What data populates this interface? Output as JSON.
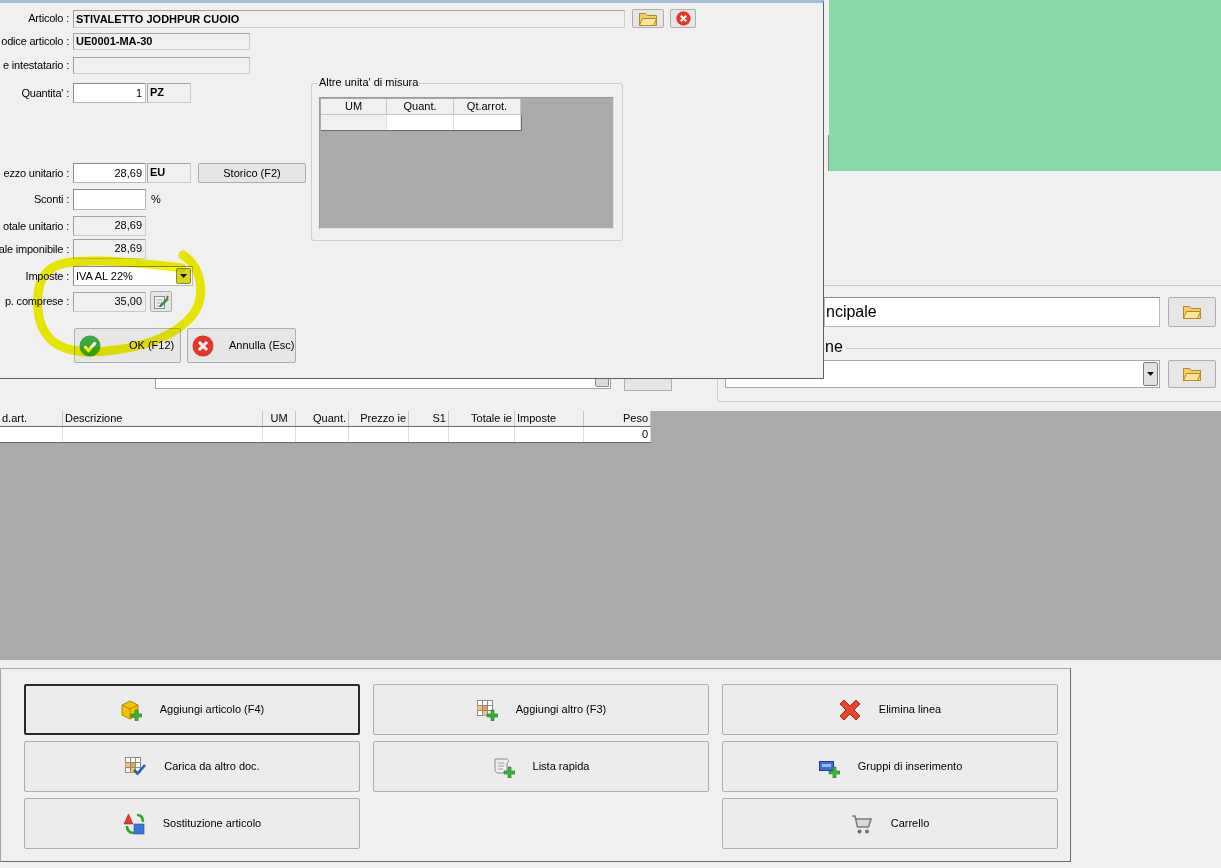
{
  "dialog": {
    "article": {
      "label": "Articolo :",
      "value": "STIVALETTO JODHPUR CUOIO"
    },
    "code": {
      "label": "odice articolo :",
      "value": "UE0001-MA-30"
    },
    "holder_code": {
      "label": "e intestatario :"
    },
    "quantity": {
      "label": "Quantita' :",
      "value": "1",
      "unit": "PZ"
    },
    "unit_price": {
      "label": "ezzo unitario :",
      "value": "28,69",
      "unit": "EU",
      "history_button": "Storico (F2)"
    },
    "discount": {
      "label": "Sconti :",
      "suffix": "%"
    },
    "unit_total": {
      "label": "otale unitario :",
      "value": "28,69"
    },
    "taxable_total": {
      "label": "ale imponibile :",
      "value": "28,69"
    },
    "tax": {
      "label": "Imposte :",
      "value": "IVA AL 22%"
    },
    "tax_included": {
      "label": "p. comprese :",
      "value": "35,00"
    },
    "buttons": [
      {
        "kind": "ok",
        "label": "OK (F12)"
      },
      {
        "kind": "cancel",
        "label": "Annulla (Esc)"
      }
    ],
    "units_group": {
      "title": "Altre unita' di misura",
      "columns": [
        "UM",
        "Quant.",
        "Qt.arrot."
      ]
    }
  },
  "main": {
    "address_field": {
      "value": "ncipale"
    },
    "payment_group": {
      "title": "ne"
    },
    "lines_table": {
      "columns": [
        "d.art.",
        "Descrizione",
        "UM",
        "Quant.",
        "Prezzo ie",
        "S1",
        "Totale ie",
        "Imposte",
        "Peso"
      ],
      "rows": [
        {
          "weight": "0"
        }
      ]
    },
    "action_columns": [
      [
        {
          "kind": "article",
          "label": "Aggiungi articolo (F4)",
          "focused": true
        },
        {
          "kind": "load",
          "label": "Carica da altro doc.",
          "focused": false
        },
        {
          "kind": "replace",
          "label": "Sostituzione articolo",
          "focused": false
        }
      ],
      [
        {
          "kind": "other",
          "label": "Aggiungi altro (F3)",
          "focused": false
        },
        {
          "kind": "quicklist",
          "label": "Lista rapida",
          "focused": false
        }
      ],
      [
        {
          "kind": "delete",
          "label": "Elimina linea",
          "focused": false
        },
        {
          "kind": "groups",
          "label": "Gruppi di inserimento",
          "focused": false
        },
        {
          "kind": "cart",
          "label": "Carrello",
          "focused": false
        }
      ]
    ]
  }
}
